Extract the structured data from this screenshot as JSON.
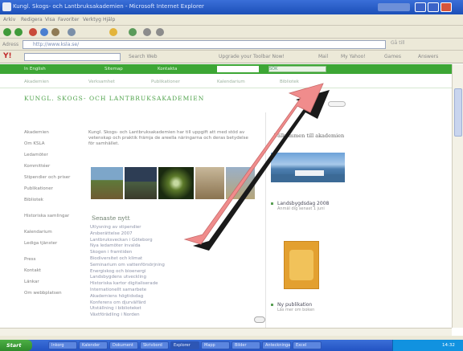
{
  "colors": {
    "title_bar": "#2a5cc8",
    "green_nav": "#3da635",
    "headline": "#4ea24a",
    "arrow_fill": "#f08c8c",
    "arrow_shadow": "#1a1a1a"
  },
  "window": {
    "title": "Kungl. Skogs- och Lantbruksakademien - Microsoft Internet Explorer",
    "icons": [
      "app-icon",
      "minimize-icon",
      "maximize-icon",
      "close-icon"
    ]
  },
  "menu": [
    "Arkiv",
    "Redigera",
    "Visa",
    "Favoriter",
    "Verktyg",
    "Hjälp"
  ],
  "toolbar": {
    "items": [
      "back-icon",
      "forward-icon",
      "stop-icon",
      "refresh-icon",
      "home-icon",
      "search-icon",
      "favorites-icon",
      "media-icon",
      "mail-icon",
      "print-icon"
    ]
  },
  "address": {
    "label": "Adress",
    "url": "http://www.ksla.se/",
    "go": "Gå till"
  },
  "links_bar": {
    "yahoo": "Y!",
    "items": [
      "Search Web",
      "Upgrade your Toolbar Now!",
      "Mail",
      "My Yahoo!",
      "Games",
      "Answers"
    ]
  },
  "site": {
    "green_nav": [
      "In English",
      "Sitemap",
      "Kontakta"
    ],
    "search_button": "SÖK",
    "subnav": [
      "Akademien",
      "Verksamhet",
      "Publikationer",
      "Kalendarium",
      "Bibliotek"
    ],
    "headline": "KUNGL. SKOGS- OCH LANTBRUKSAKADEMIEN",
    "sidebar": [
      "Akademien",
      "Om KSLA",
      "Ledamöter",
      "Kommittéer",
      "Stipendier och priser",
      "Publikationer",
      "Bibliotek",
      "Historiska samlingar",
      "Kalendarium",
      "Lediga tjänster",
      "Press",
      "Kontakt",
      "Länkar",
      "Om webbplatsen"
    ],
    "intro": "Kungl. Skogs- och Lantbruksakademien har till uppgift att med stöd av vetenskap och praktik främja de areella näringarna och deras betydelse för samhället.",
    "news_heading": "Senaste nytt",
    "news": [
      "Utlysning av stipendier",
      "Årsberättelse 2007",
      "Lantbruksveckan i Göteborg",
      "Nya ledamöter invalda",
      "Skogen i framtiden",
      "Biodiversitet och klimat",
      "Seminarium om vattenförsörjning",
      "Energiskog och bioenergi",
      "Landsbygdens utveckling",
      "Historiska kartor digitaliserade",
      "Internationellt samarbete",
      "Akademiens högtidsdag",
      "Konferens om djurvälfärd",
      "Utställning i biblioteket",
      "Växtförädling i Norden",
      "Sommarstängt",
      "Nytt nummer av Kungl. Skogs- och Lantbruksakademiens tidskrift"
    ],
    "right": {
      "heading": "Välkommen till akademien",
      "event_title": "Landsbygdsdag 2008",
      "event_sub": "Anmäl dig senast 1 juni",
      "book_title": "Ny publikation",
      "book_sub": "Läs mer om boken"
    }
  },
  "taskbar": {
    "start": "Start",
    "tasks": [
      "Inkorg",
      "Kalender",
      "Dokument",
      "Skrivbord",
      "Explorer",
      "Mapp",
      "Bilder",
      "Anteckningar",
      "Excel"
    ],
    "clock": "14:32"
  }
}
